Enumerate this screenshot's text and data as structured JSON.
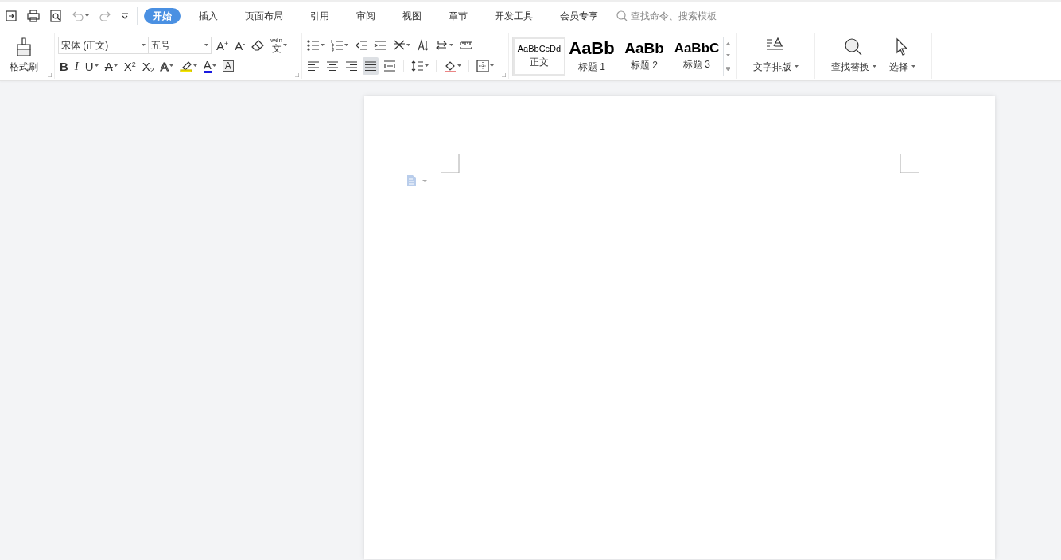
{
  "toolbar": {
    "tabs": [
      {
        "label": "开始",
        "selected": true
      },
      {
        "label": "插入",
        "selected": false
      },
      {
        "label": "页面布局",
        "selected": false
      },
      {
        "label": "引用",
        "selected": false
      },
      {
        "label": "审阅",
        "selected": false
      },
      {
        "label": "视图",
        "selected": false
      },
      {
        "label": "章节",
        "selected": false
      },
      {
        "label": "开发工具",
        "selected": false
      },
      {
        "label": "会员专享",
        "selected": false
      }
    ],
    "search": {
      "placeholder": "查找命令、搜索模板"
    }
  },
  "ribbon": {
    "format_painter": {
      "label": "格式刷"
    },
    "font": {
      "name": "宋体 (正文)",
      "size": "五号"
    },
    "font_row1": [
      {
        "kind": "grow",
        "glyph": "A$^{+}$",
        "dropdown": false
      },
      {
        "kind": "shrink",
        "glyph": "A$^{-}$",
        "dropdown": false
      },
      {
        "kind": "clear",
        "dropdown": false
      },
      {
        "kind": "pinyin",
        "glyph": "文",
        "ruby": "wén",
        "dropdown": true
      }
    ],
    "font_row2": [
      {
        "kind": "bold",
        "glyph": "B",
        "dropdown": false
      },
      {
        "kind": "italic",
        "glyph": "I",
        "dropdown": false
      },
      {
        "kind": "underline",
        "glyph": "U",
        "dropdown": true
      },
      {
        "kind": "strike",
        "glyph": "A",
        "dropdown": true
      },
      {
        "kind": "sup",
        "glyph": "X$^{2}$",
        "dropdown": false
      },
      {
        "kind": "sub",
        "glyph": "X$_{2}$",
        "dropdown": false
      },
      {
        "kind": "effect",
        "glyph": "A",
        "dropdown": true
      },
      {
        "kind": "highlight",
        "dropdown": true
      },
      {
        "kind": "color",
        "glyph": "A",
        "dropdown": true
      },
      {
        "kind": "charborder",
        "glyph": "A",
        "dropdown": false
      }
    ],
    "para_row1": [
      {
        "kind": "bullets",
        "dropdown": true
      },
      {
        "kind": "numbering",
        "dropdown": true
      },
      {
        "kind": "outdent",
        "dropdown": false
      },
      {
        "kind": "indent",
        "dropdown": false
      },
      {
        "kind": "cjk",
        "dropdown": true
      },
      {
        "kind": "sort",
        "dropdown": false
      },
      {
        "kind": "marks",
        "dropdown": true
      },
      {
        "kind": "tabs",
        "dropdown": false
      }
    ],
    "alignment": [
      {
        "kind": "left",
        "selected": false
      },
      {
        "kind": "center",
        "selected": false
      },
      {
        "kind": "right",
        "selected": false
      },
      {
        "kind": "justify",
        "selected": true
      },
      {
        "kind": "distributed",
        "selected": false
      }
    ],
    "para_row2": [
      {
        "kind": "spacing",
        "dropdown": true
      },
      {
        "kind": "shading",
        "dropdown": true
      },
      {
        "kind": "borders",
        "dropdown": true
      }
    ],
    "styles": [
      {
        "kind": "body",
        "preview": "AaBbCcDd",
        "label": "正文",
        "selected": true
      },
      {
        "kind": "h1",
        "preview": "AaBb",
        "label": "标题 1",
        "selected": false
      },
      {
        "kind": "h2",
        "preview": "AaBb",
        "label": "标题 2",
        "selected": false
      },
      {
        "kind": "h3",
        "preview": "AaBbC",
        "label": "标题 3",
        "selected": false
      }
    ],
    "big_buttons": [
      {
        "kind": "layout",
        "label": "文字排版",
        "dropdown": true
      },
      {
        "kind": "find",
        "label": "查找替换",
        "dropdown": true
      },
      {
        "kind": "select",
        "label": "选择",
        "dropdown": true
      }
    ]
  }
}
